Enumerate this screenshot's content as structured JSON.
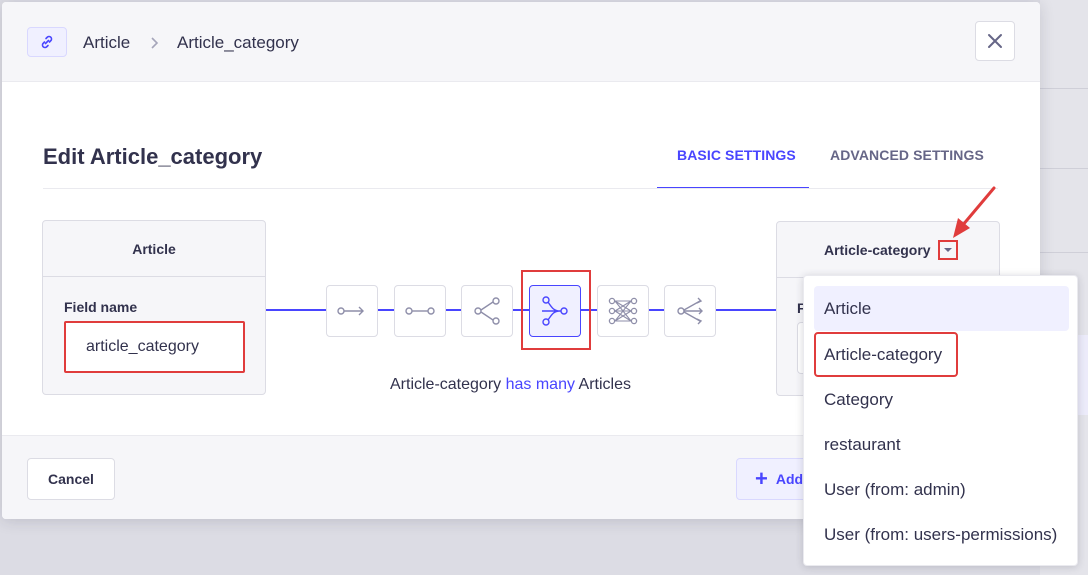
{
  "header": {
    "breadcrumb_parent": "Article",
    "breadcrumb_current": "Article_category",
    "badge_icon": "link-icon"
  },
  "modal": {
    "title": "Edit Article_category",
    "tabs": [
      {
        "label": "BASIC SETTINGS",
        "active": true
      },
      {
        "label": "ADVANCED SETTINGS",
        "active": false
      }
    ]
  },
  "left_box": {
    "title": "Article",
    "field_label": "Field name",
    "field_value": "article_category"
  },
  "right_box": {
    "title": "Article-category",
    "field_label_fragment": "F"
  },
  "relations": {
    "icons": [
      "one-way-icon",
      "one-to-one-icon",
      "one-to-many-icon",
      "many-to-one-icon",
      "many-to-many-icon",
      "many-way-icon"
    ],
    "selected_index": 3,
    "description_prefix": "Article-category",
    "description_accent": "has many",
    "description_suffix": "Articles"
  },
  "footer": {
    "cancel_label": "Cancel",
    "add_label_fragment": "Add"
  },
  "dropdown": {
    "options": [
      "Article",
      "Article-category",
      "Category",
      "restaurant",
      "User (from: admin)",
      "User (from: users-permissions)"
    ],
    "hovered_index": 0,
    "selected_index": 1
  },
  "colors": {
    "primary": "#4945ff",
    "annotation": "#e03c3c",
    "text": "#32324d"
  }
}
